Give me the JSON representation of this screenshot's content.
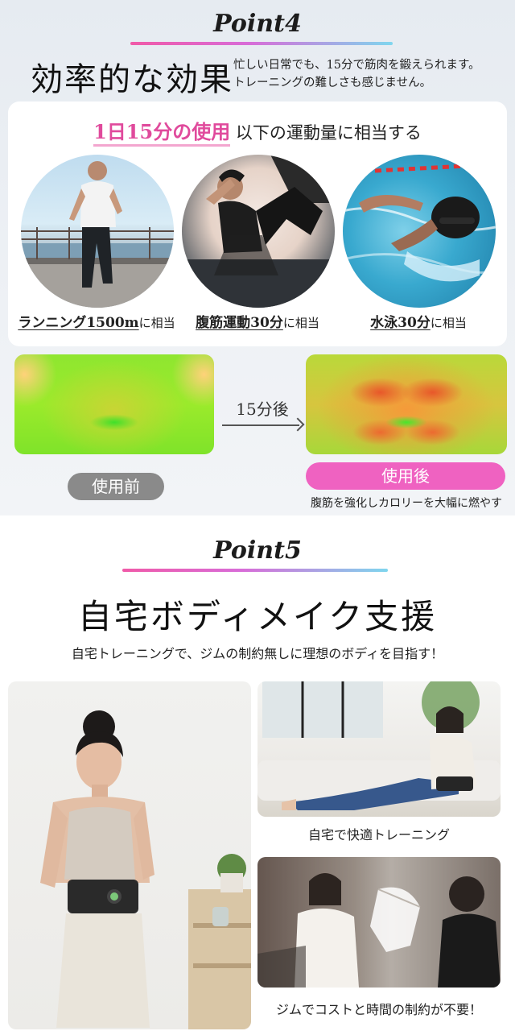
{
  "point4": {
    "label": "Point4",
    "heading": "効率的な効果",
    "note_line1": "忙しい日常でも、15分で筋肉を鍛えられます。",
    "note_line2": "トレーニングの難しさも感じません。",
    "card": {
      "title_highlight": "1日15分の使用",
      "title_rest": " 以下の運動量に相当する",
      "items": [
        {
          "bold": "ランニング1500m",
          "suffix": "に相当"
        },
        {
          "bold": "腹筋運動30分",
          "suffix": "に相当"
        },
        {
          "bold": "水泳30分",
          "suffix": "に相当"
        }
      ]
    },
    "arrow_label": "15分後",
    "before_label": "使用前",
    "after_label": "使用後",
    "after_note": "腹筋を強化しカロリーを大幅に燃やす"
  },
  "point5": {
    "label": "Point5",
    "heading": "自宅ボディメイク支援",
    "subheading": "自宅トレーニングで、ジムの制約無しに理想のボディを目指す！",
    "caption_home": "自宅で快適トレーニング",
    "caption_gym": "ジムでコストと時間の制約が不要！"
  },
  "colors": {
    "accent_pink": "#ef62c1",
    "highlight_pink": "#e04a9c",
    "before_gray": "#8a8a8a"
  }
}
